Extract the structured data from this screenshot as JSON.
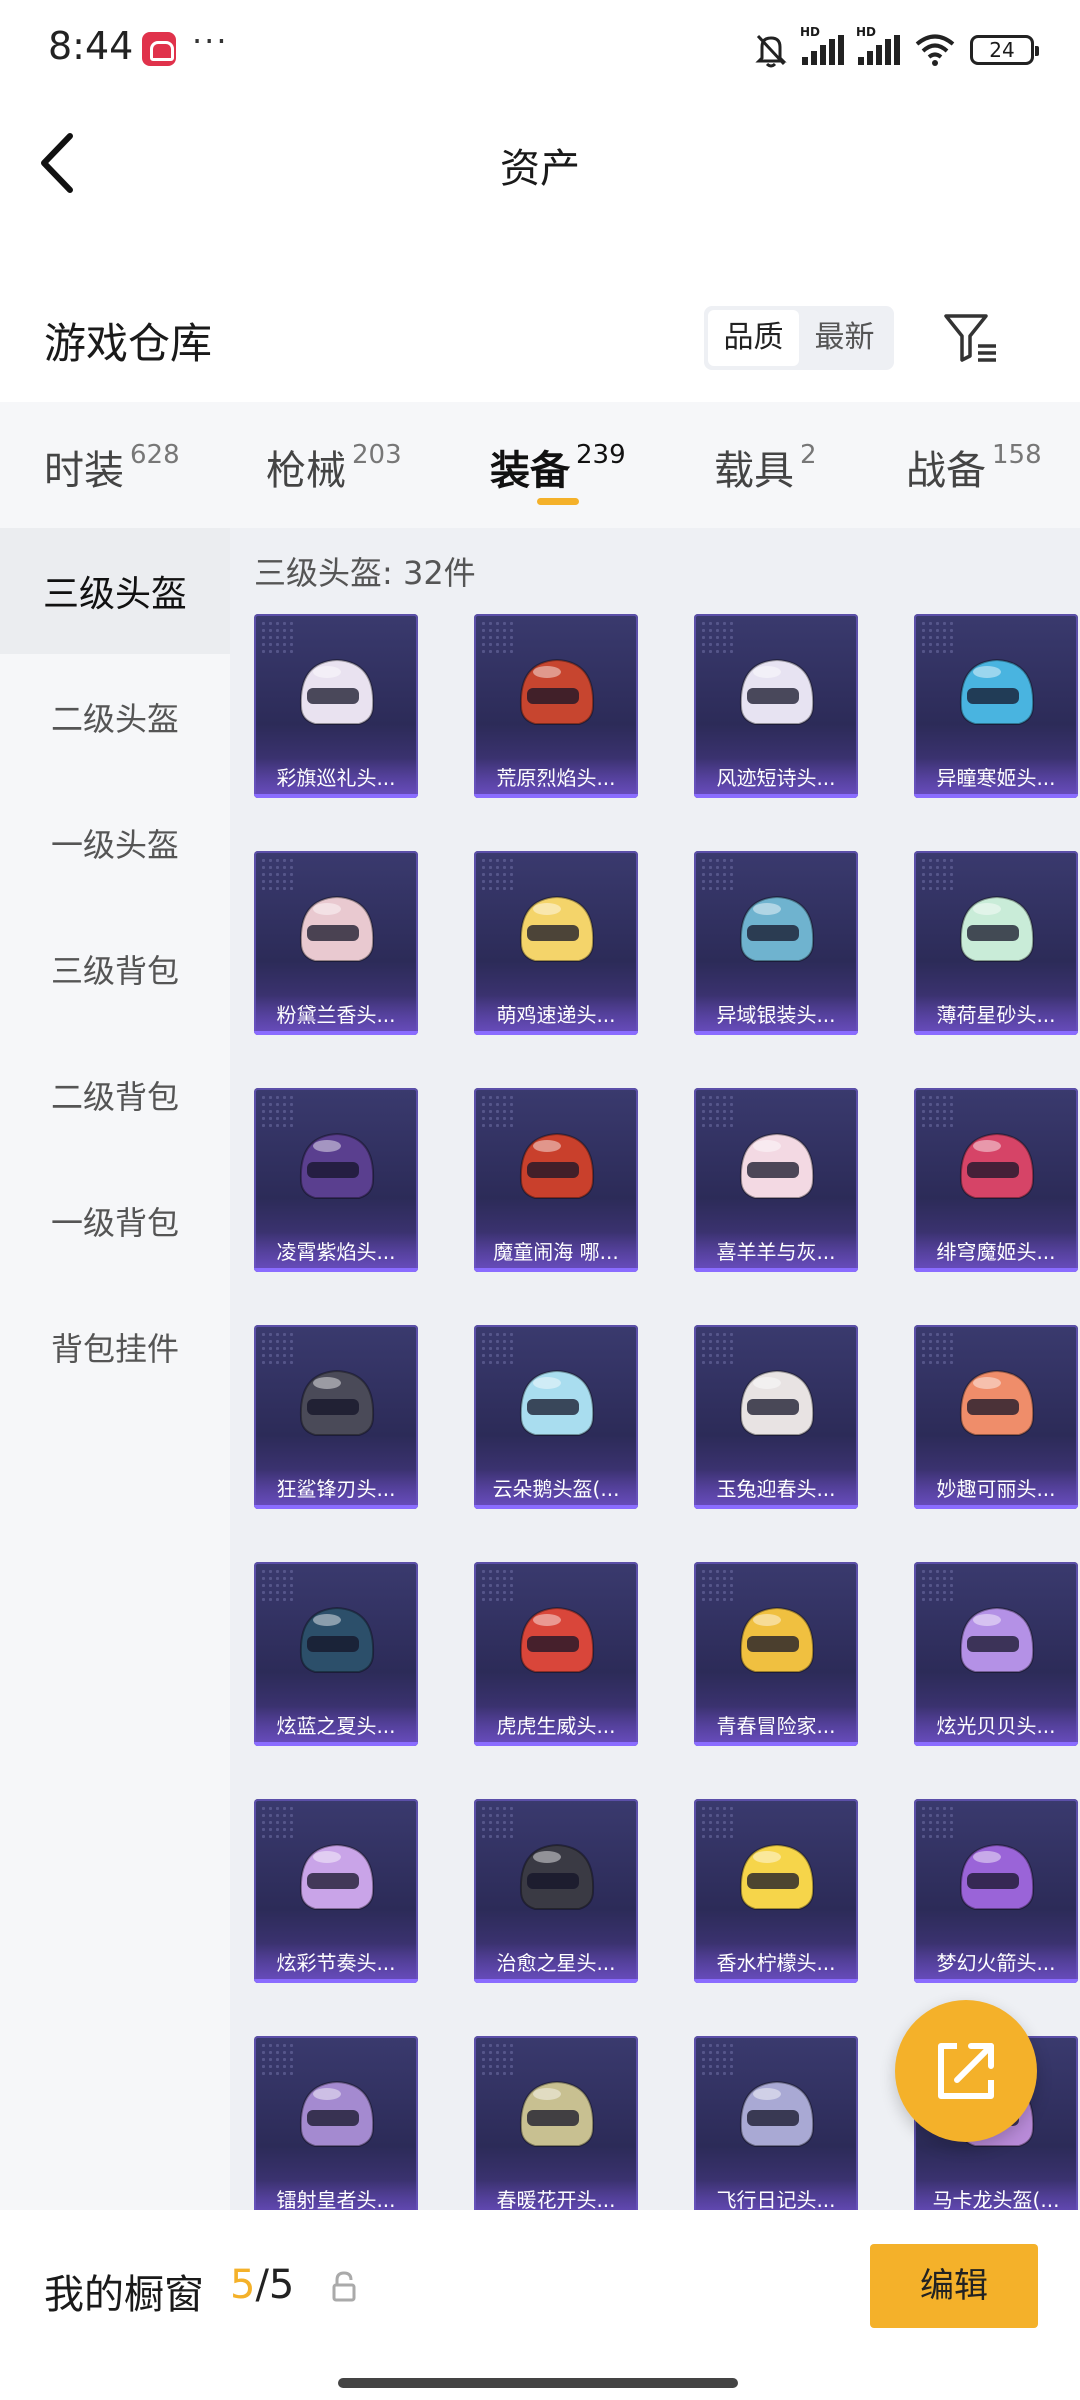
{
  "status_bar": {
    "time": "8:44",
    "battery": "24",
    "icons": [
      "app-icon",
      "more-dots-icon",
      "mute-bell-icon",
      "hd-signal-icon",
      "hd-signal-icon",
      "wifi-icon",
      "battery-icon"
    ],
    "signal_tags": [
      "HD",
      "HD"
    ]
  },
  "header": {
    "title": "资产",
    "back_icon": "chevron-left-icon"
  },
  "warehouse": {
    "title": "游戏仓库",
    "sort_options": [
      "品质",
      "最新"
    ],
    "sort_selected": "品质",
    "filter_icon": "filter-icon"
  },
  "tabs": [
    {
      "label": "时装",
      "count": "628"
    },
    {
      "label": "枪械",
      "count": "203"
    },
    {
      "label": "装备",
      "count": "239",
      "active": true
    },
    {
      "label": "载具",
      "count": "2"
    },
    {
      "label": "战备",
      "count": "158"
    }
  ],
  "sidebar": {
    "items": [
      "三级头盔",
      "二级头盔",
      "一级头盔",
      "三级背包",
      "二级背包",
      "一级背包",
      "背包挂件"
    ],
    "selected": "三级头盔"
  },
  "grid": {
    "count_label": "三级头盔: 32件",
    "items": [
      "彩旗巡礼头...",
      "荒原烈焰头...",
      "风迹短诗头...",
      "异瞳寒姬头...",
      "粉黛兰香头...",
      "萌鸡速递头...",
      "异域银装头...",
      "薄荷星砂头...",
      "凌霄紫焰头...",
      "魔童闹海 哪...",
      "喜羊羊与灰...",
      "绯穹魔姬头...",
      "狂鲨锋刃头...",
      "云朵鹅头盔(...",
      "玉兔迎春头...",
      "妙趣可丽头...",
      "炫蓝之夏头...",
      "虎虎生威头...",
      "青春冒险家...",
      "炫光贝贝头...",
      "炫彩节奏头...",
      "治愈之星头...",
      "香水柠檬头...",
      "梦幻火箭头...",
      "镭射皇者头...",
      "春暖花开头...",
      "飞行日记头...",
      "马卡龙头盔(..."
    ],
    "helmet_colors": [
      "#e9e2f0",
      "#c7452f",
      "#e7e3f2",
      "#49b4e0",
      "#e9c9d0",
      "#f4d46a",
      "#6fb3cf",
      "#c9ecd8",
      "#5a3f8f",
      "#c9402c",
      "#f3d9e3",
      "#d64467",
      "#4a4a58",
      "#a9ddef",
      "#e8e3e3",
      "#ef8d6a",
      "#2c4f6a",
      "#d9463a",
      "#f0c040",
      "#b491e6",
      "#c9a4e8",
      "#3a3a44",
      "#f6d54a",
      "#9a64d8",
      "#a48ad0",
      "#c8c091",
      "#a9a9d4",
      "#b98bd9"
    ]
  },
  "fab": {
    "icon": "share-external-icon"
  },
  "bottom_bar": {
    "label": "我的橱窗",
    "current": "5",
    "separator_total": "/5",
    "lock_icon": "lock-icon",
    "edit_label": "编辑"
  },
  "accent_color": "#f4b12a"
}
